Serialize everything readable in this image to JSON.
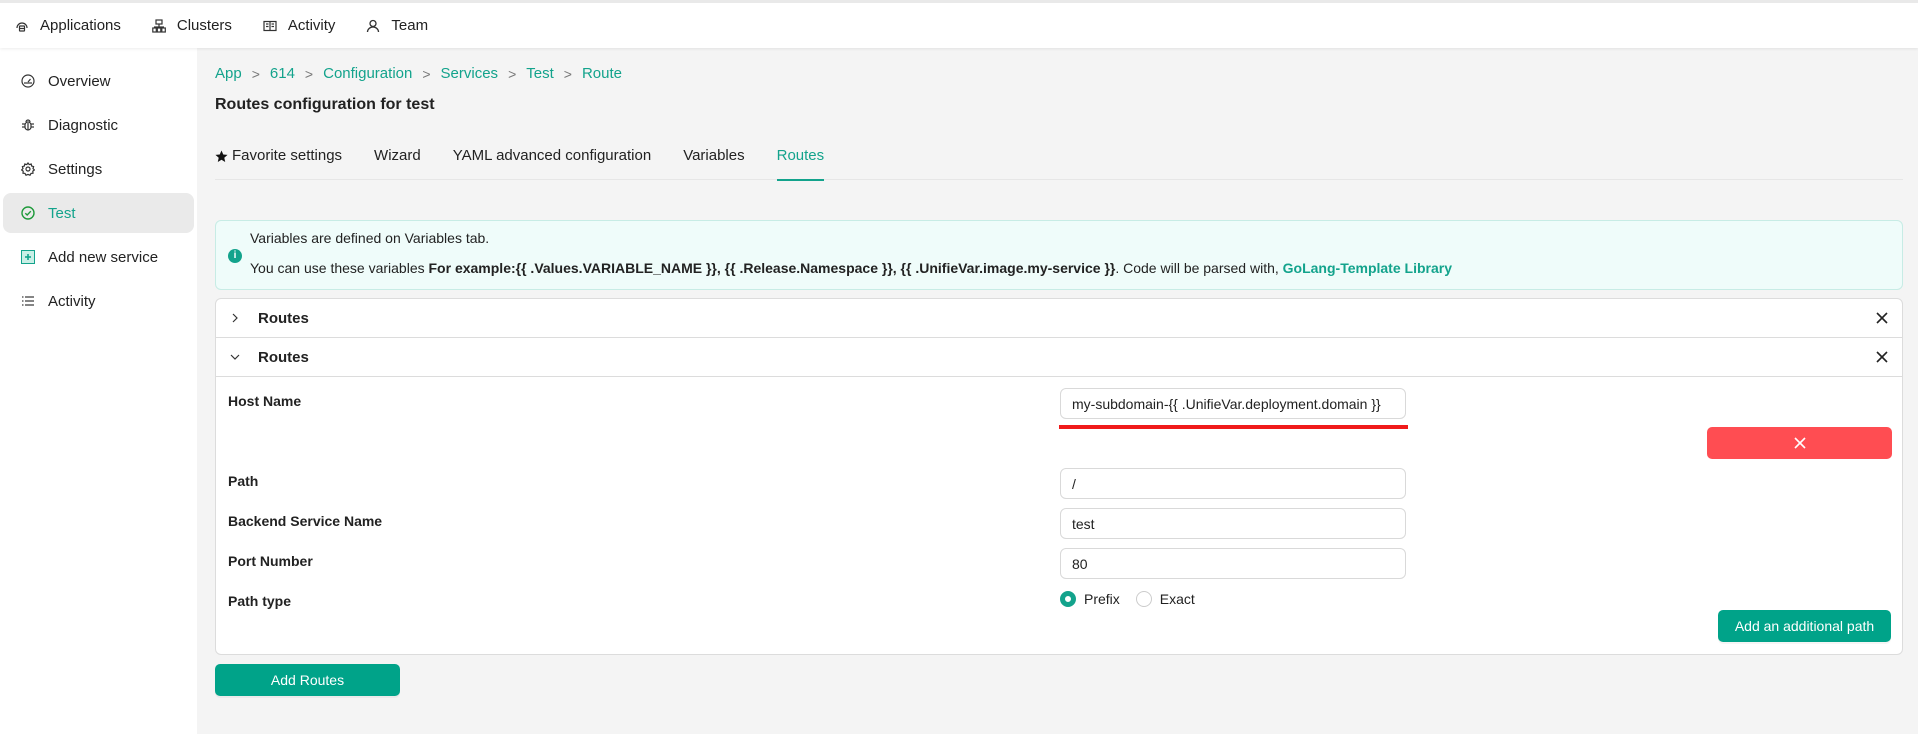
{
  "topnav": {
    "items": [
      {
        "label": "Applications",
        "icon": "applications-icon"
      },
      {
        "label": "Clusters",
        "icon": "clusters-icon"
      },
      {
        "label": "Activity",
        "icon": "activity-book-icon"
      },
      {
        "label": "Team",
        "icon": "user-icon"
      }
    ]
  },
  "sidebar": {
    "items": [
      {
        "label": "Overview",
        "icon": "dashboard-icon"
      },
      {
        "label": "Diagnostic",
        "icon": "bug-icon"
      },
      {
        "label": "Settings",
        "icon": "gear-icon"
      },
      {
        "label": "Test",
        "icon": "check-circle-icon",
        "active": true
      },
      {
        "label": "Add new service",
        "icon": "plus-square-icon"
      },
      {
        "label": "Activity",
        "icon": "list-icon"
      }
    ]
  },
  "breadcrumb": [
    "App",
    "614",
    "Configuration",
    "Services",
    "Test",
    "Route"
  ],
  "breadcrumb_separator": ">",
  "page_title": "Routes configuration for test",
  "tabs": [
    {
      "label": "Favorite settings",
      "icon": "star-icon"
    },
    {
      "label": "Wizard"
    },
    {
      "label": "YAML advanced configuration"
    },
    {
      "label": "Variables"
    },
    {
      "label": "Routes",
      "active": true
    }
  ],
  "info": {
    "line1": "Variables are defined on Variables tab.",
    "line2_prefix": "You can use these variables ",
    "line2_example": "For example:{{ .Values.VARIABLE_NAME }}, {{ .Release.Namespace }}, {{ .UnifieVar.image.my-service }}",
    "line2_suffix": ". Code will be parsed with, ",
    "link": "GoLang-Template Library"
  },
  "routes": {
    "panels": [
      {
        "title": "Routes",
        "expanded": false
      },
      {
        "title": "Routes",
        "expanded": true
      }
    ],
    "form": {
      "host_name_label": "Host Name",
      "host_name_value": "my-subdomain-{{ .UnifieVar.deployment.domain }}",
      "path_label": "Path",
      "path_value": "/",
      "backend_label": "Backend Service Name",
      "backend_value": "test",
      "port_label": "Port Number",
      "port_value": "80",
      "path_type_label": "Path type",
      "path_type_options": [
        "Prefix",
        "Exact"
      ],
      "path_type_selected": "Prefix"
    },
    "add_path_button": "Add an additional path",
    "add_routes_button": "Add Routes"
  },
  "colors": {
    "accent": "#13a38c",
    "danger": "#ff4d52",
    "error_underline": "#f01a1a"
  }
}
